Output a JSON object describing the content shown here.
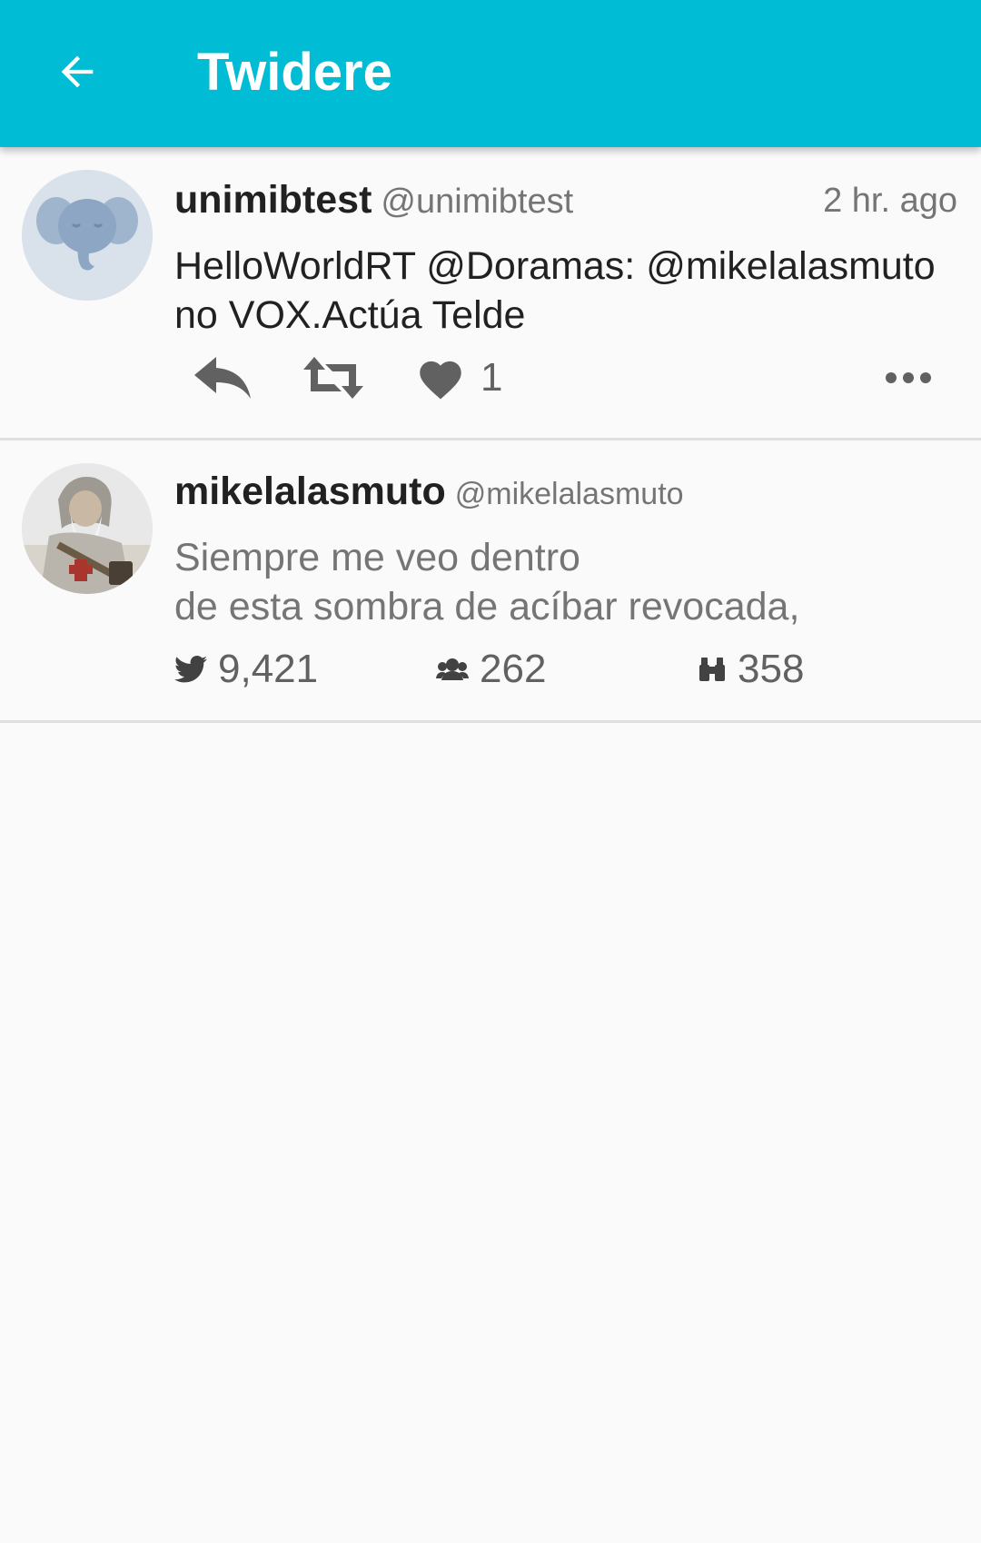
{
  "appbar": {
    "title": "Twidere",
    "back_icon": "arrow-left-icon",
    "background": "#00bcd4"
  },
  "tweet": {
    "display_name": "unimibtest",
    "handle": "@unimibtest",
    "time": "2 hr. ago",
    "text": "HelloWorldRT @Doramas: @mikelalasmuto\nno VOX.Actúa Telde",
    "avatar_icon": "elephant-avatar-icon",
    "actions": {
      "reply_icon": "reply-icon",
      "retweet_icon": "retweet-icon",
      "like_icon": "heart-icon",
      "like_count": "1",
      "more_icon": "more-horiz-icon"
    }
  },
  "user": {
    "display_name": "mikelalasmuto",
    "handle": "@mikelalasmuto",
    "bio": "Siempre me veo dentro\nde esta sombra de acíbar revocada,",
    "avatar_icon": "user-avatar-image",
    "stats": {
      "tweets": "9,421",
      "following": "262",
      "followers": "358",
      "tweets_icon": "bird-icon",
      "following_icon": "group-icon",
      "followers_icon": "binoculars-icon"
    }
  }
}
